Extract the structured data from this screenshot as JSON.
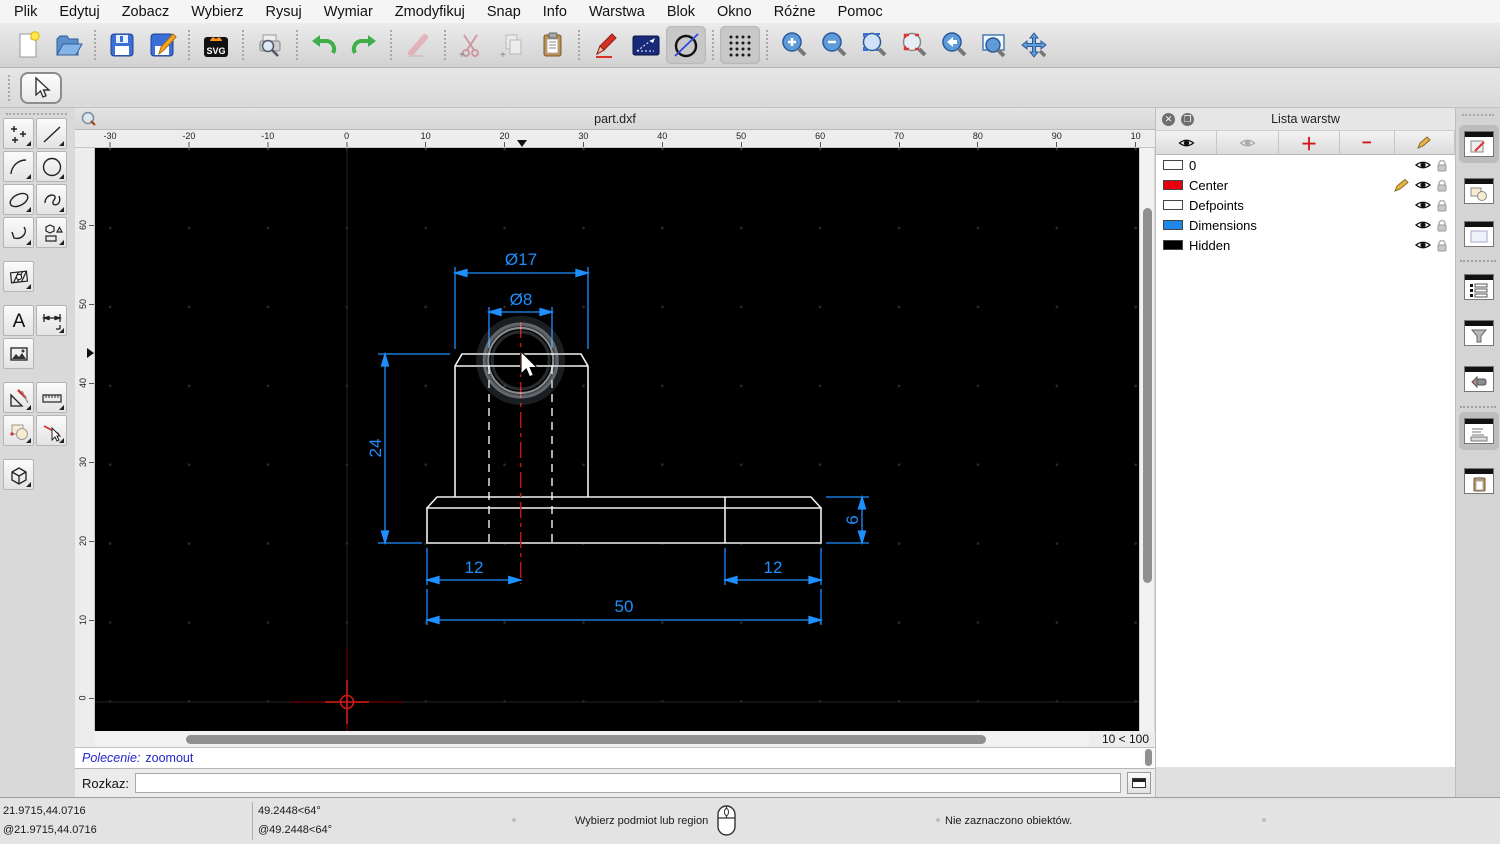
{
  "menu": {
    "items": [
      "Plik",
      "Edytuj",
      "Zobacz",
      "Wybierz",
      "Rysuj",
      "Wymiar",
      "Zmodyfikuj",
      "Snap",
      "Info",
      "Warstwa",
      "Blok",
      "Okno",
      "Różne",
      "Pomoc"
    ]
  },
  "toolbar": {
    "icons": [
      "new-file",
      "open-file",
      "save",
      "save-as",
      "export-svg",
      "print-preview",
      "undo",
      "redo",
      "delete",
      "cut",
      "copy",
      "paste",
      "pen",
      "angle-dimension",
      "construction-circle",
      "grid-toggle",
      "zoom-in",
      "zoom-out",
      "zoom-auto",
      "zoom-redraw",
      "zoom-previous",
      "zoom-window",
      "zoom-pan"
    ]
  },
  "left_palette": {
    "tools": [
      "selection",
      "points",
      "line",
      "arc",
      "circle",
      "ellipse",
      "spline",
      "polyline",
      "shapes",
      "hatch",
      "text",
      "dimension",
      "image",
      "modify",
      "measure",
      "blocks",
      "select-entity",
      "solid-3d"
    ]
  },
  "document": {
    "title": "part.dxf"
  },
  "rulers": {
    "h_ticks": [
      "-30",
      "-20",
      "-10",
      "0",
      "10",
      "20",
      "30",
      "40",
      "50",
      "60",
      "70",
      "80",
      "90",
      "10"
    ],
    "v_ticks": [
      "60",
      "50",
      "40",
      "30",
      "20",
      "10",
      "0"
    ]
  },
  "drawing": {
    "dim_dia17": "Ø17",
    "dim_dia8": "Ø8",
    "dim_24": "24",
    "dim_12_left": "12",
    "dim_12_right": "12",
    "dim_50": "50",
    "dim_6": "6"
  },
  "layer_panel": {
    "title": "Lista warstw",
    "layers": [
      {
        "name": "0",
        "color": "#ffffff",
        "editing": false
      },
      {
        "name": "Center",
        "color": "#e80011",
        "editing": true
      },
      {
        "name": "Defpoints",
        "color": "#ffffff",
        "editing": false
      },
      {
        "name": "Dimensions",
        "color": "#1e87e8",
        "editing": false
      },
      {
        "name": "Hidden",
        "color": "#000000",
        "editing": false
      }
    ]
  },
  "command": {
    "history_label": "Polecenie:",
    "history_value": "zoomout",
    "prompt_label": "Rozkaz:",
    "input_value": ""
  },
  "statusbar": {
    "abs_coord": "21.9715,44.0716",
    "rel_coord": "@21.9715,44.0716",
    "abs_polar": "49.2448<64°",
    "rel_polar": "@49.2448<64°",
    "hint": "Wybierz podmiot lub region",
    "selection_info": "Nie zaznaczono obiektów."
  },
  "zoom_info": "10 < 100",
  "colors": {
    "dimension_blue": "#1e8fff",
    "geometry_white": "#f2f2f2",
    "centerline_red": "#cc1414",
    "canvas_bg": "#000000"
  }
}
